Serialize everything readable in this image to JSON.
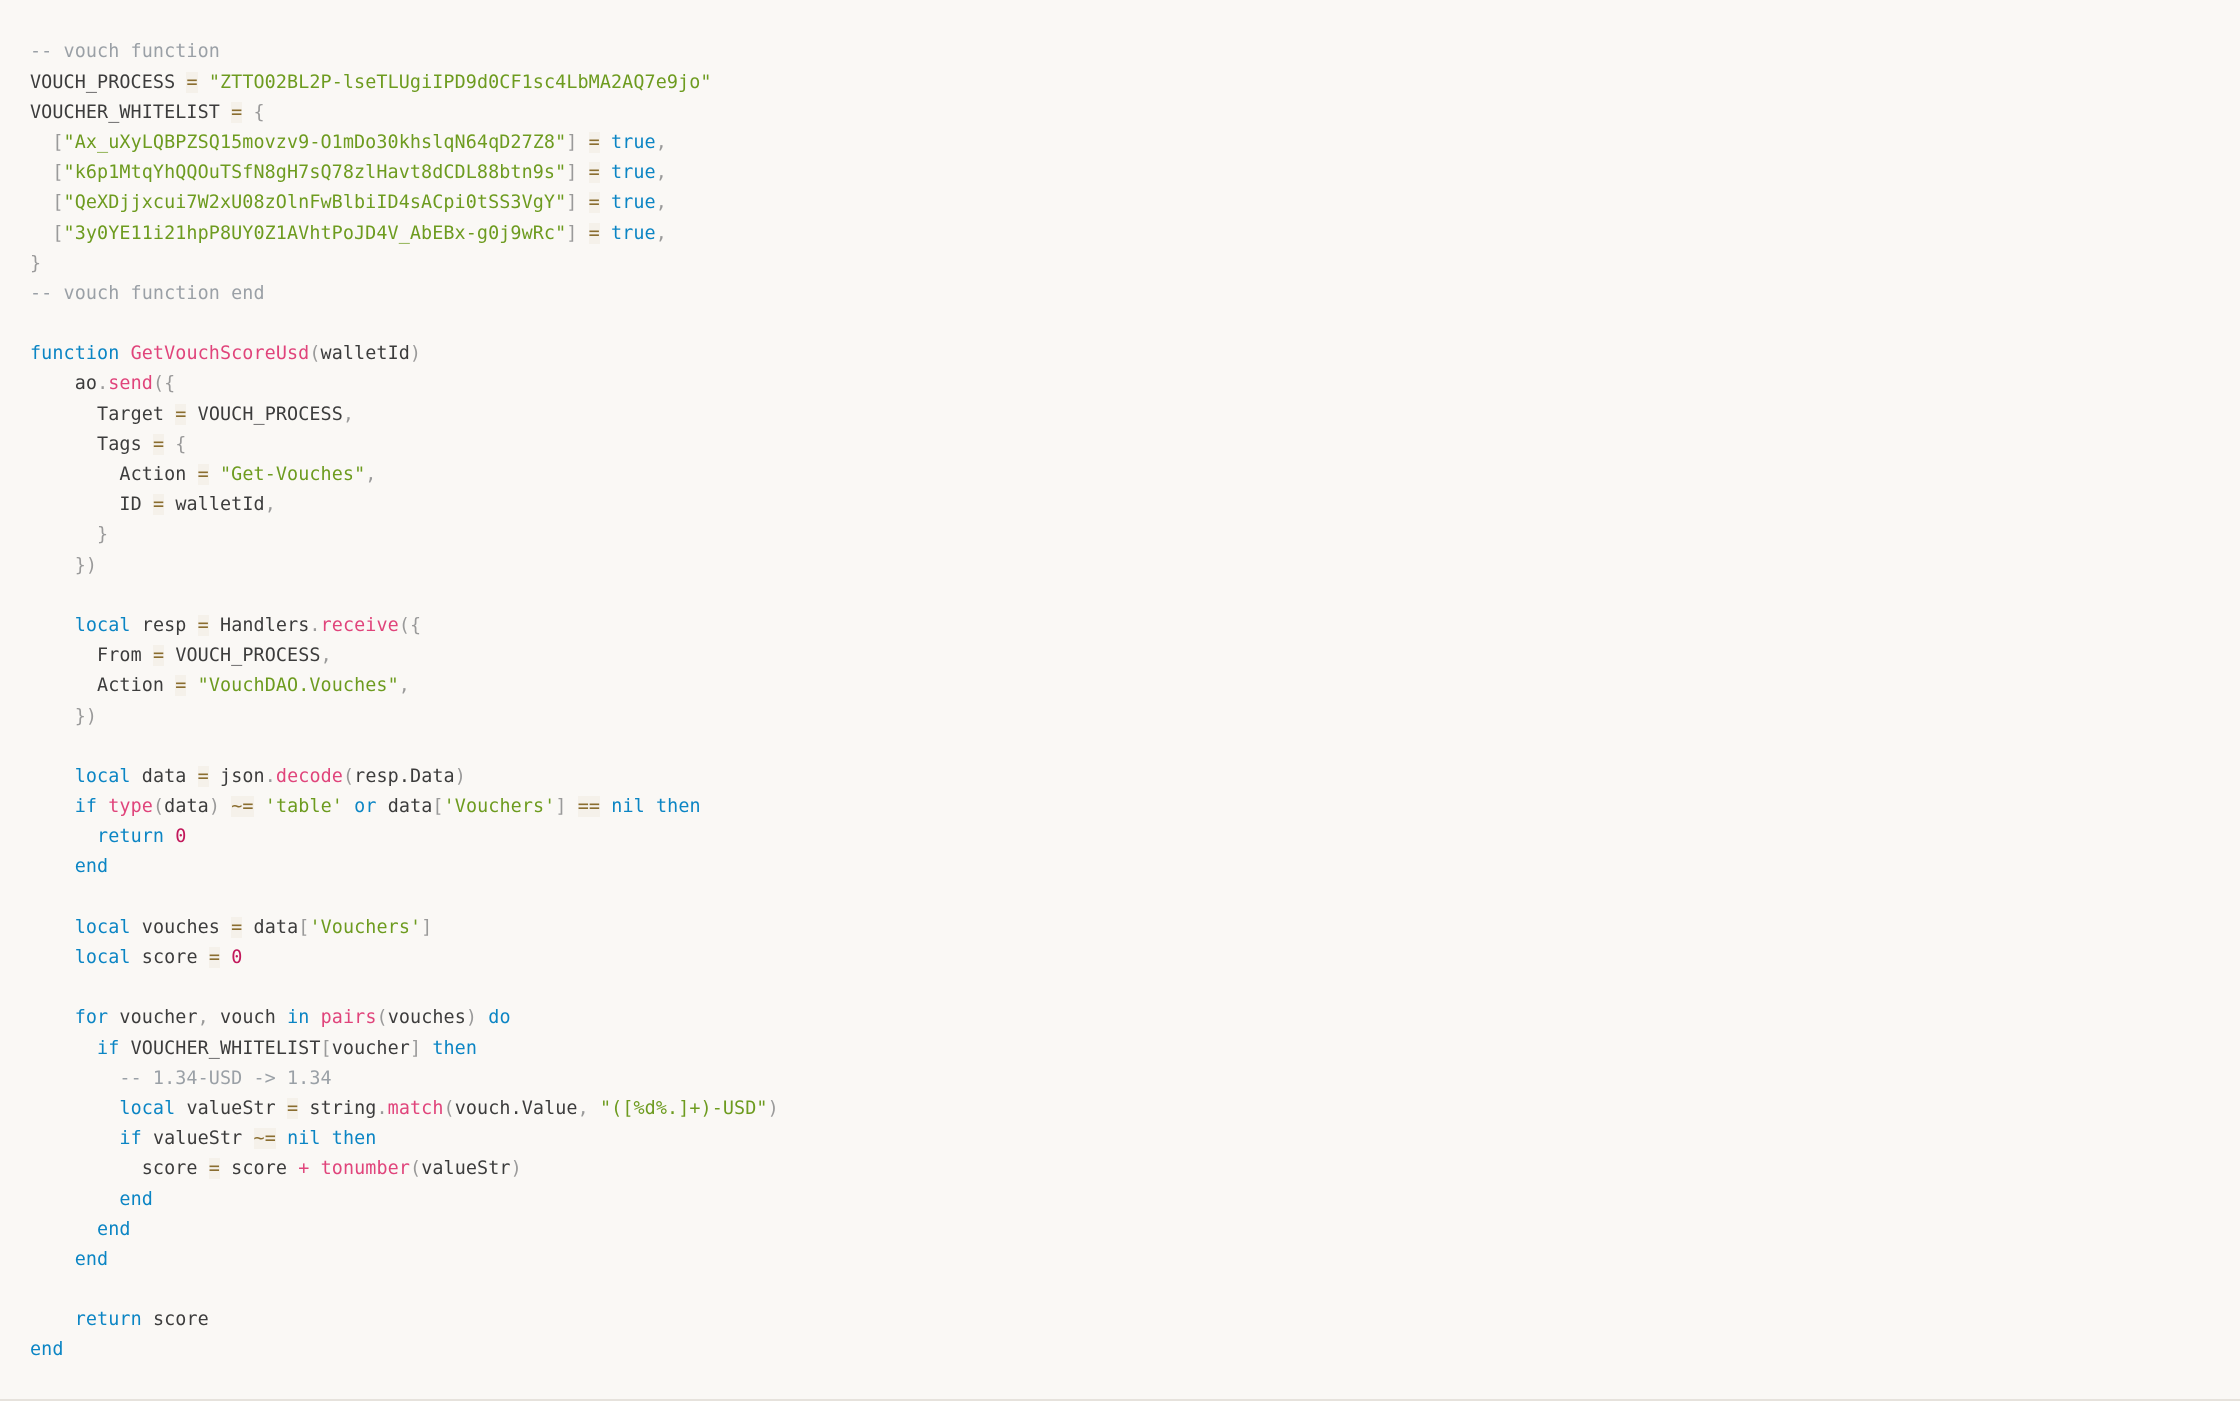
{
  "document": {
    "kind": "source-code-listing",
    "language": "lua",
    "background_color": "#faf8f5",
    "colors": {
      "comment": "#9aa0a6",
      "keyword": "#0b85c4",
      "function": "#e0447b",
      "string": "#6d9b1f",
      "number": "#c2185b",
      "operator": "#8a6d2f",
      "punctuation": "#9a9a9a",
      "plain_text": "#3c3c3c"
    }
  },
  "constants": {
    "vouch_process_name": "VOUCH_PROCESS",
    "vouch_process_value": "\"ZTTO02BL2P-lseTLUgiIPD9d0CF1sc4LbMA2AQ7e9jo\"",
    "whitelist_name": "VOUCHER_WHITELIST",
    "whitelist_keys": [
      "\"Ax_uXyLQBPZSQ15movzv9-O1mDo30khslqN64qD27Z8\"",
      "\"k6p1MtqYhQQOuTSfN8gH7sQ78zlHavt8dCDL88btn9s\"",
      "\"QeXDjjxcui7W2xU08zOlnFwBlbiID4sACpi0tSS3VgY\"",
      "\"3y0YE11i21hpP8UY0Z1AVhtPoJD4V_AbEBx-g0j9wRc\""
    ],
    "whitelist_value": "true"
  },
  "comments": {
    "vouch_function_start": "-- vouch function",
    "vouch_function_end": "-- vouch function end",
    "usd_example": "-- 1.34-USD -> 1.34"
  },
  "function_def": {
    "keyword": "function",
    "name": "GetVouchScoreUsd",
    "param": "walletId",
    "end_keyword": "end"
  },
  "tokens": {
    "ao": "ao",
    "send": "send",
    "target": "Target",
    "tags": "Tags",
    "action": "Action",
    "id": "ID",
    "walletId": "walletId",
    "get_vouches_string": "\"Get-Vouches\"",
    "local": "local",
    "resp": "resp",
    "handlers": "Handlers",
    "receive": "receive",
    "from": "From",
    "vouchdao_string": "\"VouchDAO.Vouches\"",
    "data": "data",
    "json": "json",
    "decode": "decode",
    "resp_data": "resp.Data",
    "if": "if",
    "type": "type",
    "not_equal": "~=",
    "table_string": "'table'",
    "or": "or",
    "vouchers_key": "'Vouchers'",
    "equals_equals": "==",
    "nil": "nil",
    "then": "then",
    "return": "return",
    "zero": "0",
    "end": "end",
    "vouches": "vouches",
    "score": "score",
    "for": "for",
    "voucher": "voucher",
    "vouch": "vouch",
    "in": "in",
    "pairs": "pairs",
    "do": "do",
    "valueStr": "valueStr",
    "string_lib": "string",
    "match": "match",
    "vouch_value": "vouch.Value",
    "usd_pattern": "\"([%d%.]+)-USD\"",
    "plus": "+",
    "tonumber": "tonumber",
    "assign": "="
  },
  "lines": [
    "-- vouch function",
    "VOUCH_PROCESS = \"ZTTO02BL2P-lseTLUgiIPD9d0CF1sc4LbMA2AQ7e9jo\"",
    "VOUCHER_WHITELIST = {",
    "  [\"Ax_uXyLQBPZSQ15movzv9-O1mDo30khslqN64qD27Z8\"] = true,",
    "  [\"k6p1MtqYhQQOuTSfN8gH7sQ78zlHavt8dCDL88btn9s\"] = true,",
    "  [\"QeXDjjxcui7W2xU08zOlnFwBlbiID4sACpi0tSS3VgY\"] = true,",
    "  [\"3y0YE11i21hpP8UY0Z1AVhtPoJD4V_AbEBx-g0j9wRc\"] = true,",
    "}",
    "-- vouch function end",
    "",
    "function GetVouchScoreUsd(walletId)",
    "    ao.send({",
    "      Target = VOUCH_PROCESS,",
    "      Tags = {",
    "        Action = \"Get-Vouches\",",
    "        ID = walletId,",
    "      }",
    "    })",
    "",
    "    local resp = Handlers.receive({",
    "      From = VOUCH_PROCESS,",
    "      Action = \"VouchDAO.Vouches\",",
    "    })",
    "",
    "    local data = json.decode(resp.Data)",
    "    if type(data) ~= 'table' or data['Vouchers'] == nil then",
    "      return 0",
    "    end",
    "",
    "    local vouches = data['Vouchers']",
    "    local score = 0",
    "",
    "    for voucher, vouch in pairs(vouches) do",
    "      if VOUCHER_WHITELIST[voucher] then",
    "        -- 1.34-USD -> 1.34",
    "        local valueStr = string.match(vouch.Value, \"([%d%.]+)-USD\")",
    "        if valueStr ~= nil then",
    "          score = score + tonumber(valueStr)",
    "        end",
    "      end",
    "    end",
    "",
    "    return score",
    "end"
  ]
}
